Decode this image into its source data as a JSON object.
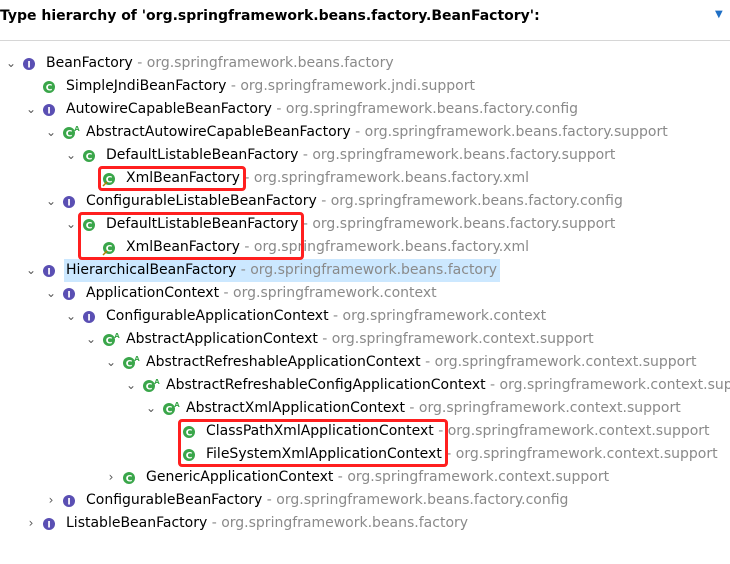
{
  "header": {
    "title": "Type hierarchy of 'org.springframework.beans.factory.BeanFactory':",
    "menu_icon": "view-menu-chevron-icon"
  },
  "tree": [
    {
      "id": "r0",
      "depth": 0,
      "toggle": "expanded",
      "icon": "interface",
      "name": "BeanFactory",
      "package": "org.springframework.beans.factory"
    },
    {
      "id": "r1",
      "depth": 1,
      "toggle": "none",
      "icon": "class",
      "name": "SimpleJndiBeanFactory",
      "package": "org.springframework.jndi.support"
    },
    {
      "id": "r2",
      "depth": 1,
      "toggle": "expanded",
      "icon": "interface",
      "name": "AutowireCapableBeanFactory",
      "package": "org.springframework.beans.factory.config"
    },
    {
      "id": "r3",
      "depth": 2,
      "toggle": "expanded",
      "icon": "abstract-class",
      "name": "AbstractAutowireCapableBeanFactory",
      "package": "org.springframework.beans.factory.support"
    },
    {
      "id": "r4",
      "depth": 3,
      "toggle": "expanded",
      "icon": "class",
      "name": "DefaultListableBeanFactory",
      "package": "org.springframework.beans.factory.support"
    },
    {
      "id": "r5",
      "depth": 4,
      "toggle": "none",
      "icon": "deprecated-class",
      "name": "XmlBeanFactory",
      "package": "org.springframework.beans.factory.xml"
    },
    {
      "id": "r6",
      "depth": 2,
      "toggle": "expanded",
      "icon": "interface",
      "name": "ConfigurableListableBeanFactory",
      "package": "org.springframework.beans.factory.config"
    },
    {
      "id": "r7",
      "depth": 3,
      "toggle": "expanded",
      "icon": "class",
      "name": "DefaultListableBeanFactory",
      "package": "org.springframework.beans.factory.support"
    },
    {
      "id": "r8",
      "depth": 4,
      "toggle": "none",
      "icon": "deprecated-class",
      "name": "XmlBeanFactory",
      "package": "org.springframework.beans.factory.xml"
    },
    {
      "id": "r9",
      "depth": 1,
      "toggle": "expanded",
      "icon": "interface",
      "name": "HierarchicalBeanFactory",
      "package": "org.springframework.beans.factory",
      "selected": true
    },
    {
      "id": "r10",
      "depth": 2,
      "toggle": "expanded",
      "icon": "interface",
      "name": "ApplicationContext",
      "package": "org.springframework.context"
    },
    {
      "id": "r11",
      "depth": 3,
      "toggle": "expanded",
      "icon": "interface",
      "name": "ConfigurableApplicationContext",
      "package": "org.springframework.context"
    },
    {
      "id": "r12",
      "depth": 4,
      "toggle": "expanded",
      "icon": "abstract-class",
      "name": "AbstractApplicationContext",
      "package": "org.springframework.context.support"
    },
    {
      "id": "r13",
      "depth": 5,
      "toggle": "expanded",
      "icon": "abstract-class",
      "name": "AbstractRefreshableApplicationContext",
      "package": "org.springframework.context.support"
    },
    {
      "id": "r14",
      "depth": 6,
      "toggle": "expanded",
      "icon": "abstract-class",
      "name": "AbstractRefreshableConfigApplicationContext",
      "package": "org.springframework.context.support"
    },
    {
      "id": "r15",
      "depth": 7,
      "toggle": "expanded",
      "icon": "abstract-class",
      "name": "AbstractXmlApplicationContext",
      "package": "org.springframework.context.support"
    },
    {
      "id": "r16",
      "depth": 8,
      "toggle": "none",
      "icon": "class",
      "name": "ClassPathXmlApplicationContext",
      "package": "org.springframework.context.support"
    },
    {
      "id": "r17",
      "depth": 8,
      "toggle": "none",
      "icon": "class",
      "name": "FileSystemXmlApplicationContext",
      "package": "org.springframework.context.support"
    },
    {
      "id": "r18",
      "depth": 5,
      "toggle": "collapsed",
      "icon": "class",
      "name": "GenericApplicationContext",
      "package": "org.springframework.context.support"
    },
    {
      "id": "r19",
      "depth": 2,
      "toggle": "collapsed",
      "icon": "interface",
      "name": "ConfigurableBeanFactory",
      "package": "org.springframework.beans.factory.config"
    },
    {
      "id": "r20",
      "depth": 1,
      "toggle": "collapsed",
      "icon": "interface",
      "name": "ListableBeanFactory",
      "package": "org.springframework.beans.factory"
    }
  ],
  "separator": " - ",
  "highlights": [
    {
      "rows": [
        "r5"
      ],
      "color": "#ff1f1f"
    },
    {
      "rows": [
        "r7",
        "r8"
      ],
      "color": "#ff1f1f"
    },
    {
      "rows": [
        "r16",
        "r17"
      ],
      "color": "#ff1f1f"
    }
  ],
  "colors": {
    "interface_icon": "#5a4fb3",
    "class_icon": "#3aa64a",
    "selection": "#cce8ff",
    "package_text": "#8a8a8a",
    "highlight": "#ff1f1f"
  }
}
